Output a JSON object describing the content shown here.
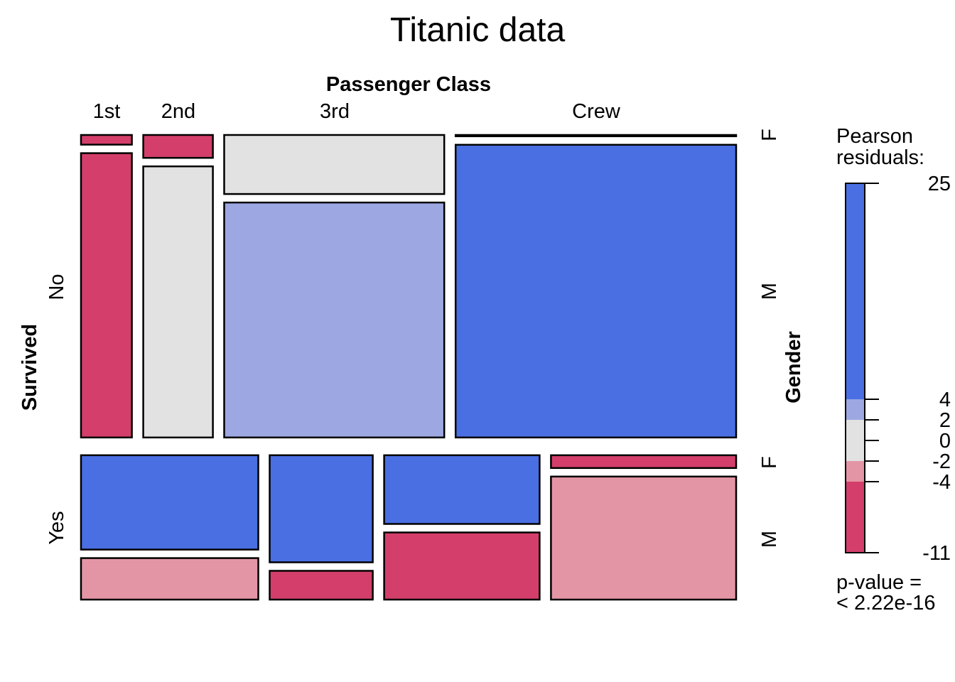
{
  "chart_data": {
    "type": "mosaic",
    "title": "Titanic data",
    "xlabel": "Passenger Class",
    "ylabel_left": "Survived",
    "ylabel_right": "Gender",
    "classes": [
      "1st",
      "2nd",
      "3rd",
      "Crew"
    ],
    "survived_levels": [
      "No",
      "Yes"
    ],
    "gender_levels": [
      "F",
      "M"
    ],
    "cells": [
      {
        "survived": "No",
        "class": "1st",
        "gender": "F",
        "count": 4,
        "residual_band": "< -4"
      },
      {
        "survived": "No",
        "class": "1st",
        "gender": "M",
        "count": 118,
        "residual_band": "< -4"
      },
      {
        "survived": "No",
        "class": "2nd",
        "gender": "F",
        "count": 13,
        "residual_band": "< -4"
      },
      {
        "survived": "No",
        "class": "2nd",
        "gender": "M",
        "count": 154,
        "residual_band": "-2..2"
      },
      {
        "survived": "No",
        "class": "3rd",
        "gender": "F",
        "count": 106,
        "residual_band": "-2..2"
      },
      {
        "survived": "No",
        "class": "3rd",
        "gender": "M",
        "count": 422,
        "residual_band": "2..4"
      },
      {
        "survived": "No",
        "class": "Crew",
        "gender": "F",
        "count": 3,
        "residual_band": "-2..2"
      },
      {
        "survived": "No",
        "class": "Crew",
        "gender": "M",
        "count": 670,
        "residual_band": "> 4"
      },
      {
        "survived": "Yes",
        "class": "1st",
        "gender": "F",
        "count": 141,
        "residual_band": "> 4"
      },
      {
        "survived": "Yes",
        "class": "1st",
        "gender": "M",
        "count": 62,
        "residual_band": "-4..-2"
      },
      {
        "survived": "Yes",
        "class": "2nd",
        "gender": "F",
        "count": 93,
        "residual_band": "> 4"
      },
      {
        "survived": "Yes",
        "class": "2nd",
        "gender": "M",
        "count": 25,
        "residual_band": "< -4"
      },
      {
        "survived": "Yes",
        "class": "3rd",
        "gender": "F",
        "count": 90,
        "residual_band": "> 4"
      },
      {
        "survived": "Yes",
        "class": "3rd",
        "gender": "M",
        "count": 88,
        "residual_band": "< -4"
      },
      {
        "survived": "Yes",
        "class": "Crew",
        "gender": "F",
        "count": 20,
        "residual_band": "< -4"
      },
      {
        "survived": "Yes",
        "class": "Crew",
        "gender": "M",
        "count": 192,
        "residual_band": "-4..-2"
      }
    ],
    "legend": {
      "title": [
        "Pearson",
        "residuals:"
      ],
      "range": [
        -11,
        25
      ],
      "ticks": [
        25,
        4,
        2,
        0,
        -2,
        -4,
        -11
      ],
      "bands": [
        {
          "from": 4,
          "to": 25,
          "color": "#4A6FE3",
          "label": "> 4"
        },
        {
          "from": 2,
          "to": 4,
          "color": "#9DA8E2",
          "label": "2..4"
        },
        {
          "from": -2,
          "to": 2,
          "color": "#E2E2E2",
          "label": "-2..2"
        },
        {
          "from": -4,
          "to": -2,
          "color": "#E495A5",
          "label": "-4..-2"
        },
        {
          "from": -11,
          "to": -4,
          "color": "#D33F6A",
          "label": "< -4"
        }
      ],
      "placement": "right",
      "pvalue_label": "p-value =",
      "pvalue": "< 2.22e-16"
    }
  }
}
